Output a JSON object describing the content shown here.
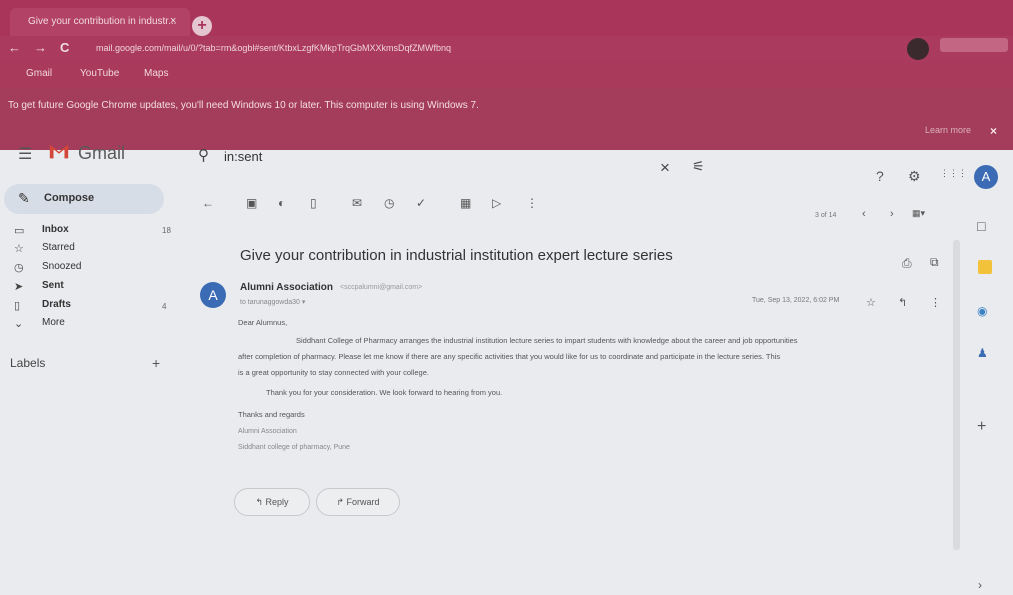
{
  "browser": {
    "tab_title": "Give your contribution in industr...",
    "tab_close": "×",
    "new_tab": "+",
    "back": "←",
    "forward": "→",
    "reload": "C",
    "url": "mail.google.com/mail/u/0/?tab=rm&ogbl#sent/KtbxLzgfKMkpTrqGbMXXkmsDqfZMWfbnq",
    "bookmarks": [
      "Gmail",
      "YouTube",
      "Maps"
    ],
    "infobar_text": "To get future Google Chrome updates, you'll need Windows 10 or later. This computer is using Windows 7.",
    "learn_more": "Learn more",
    "infobar_close": "×"
  },
  "gmail": {
    "logo_text": "Gmail",
    "menu_icon": "☰",
    "search_value": "in:sent",
    "search_clear": "×",
    "search_options": "⚟",
    "help": "?",
    "settings": "⚙",
    "apps": "⋮⋮⋮",
    "user_initial": "A"
  },
  "sidebar": {
    "compose": "Compose",
    "items": [
      {
        "icon": "▭",
        "label": "Inbox",
        "count": "18"
      },
      {
        "icon": "☆",
        "label": "Starred",
        "count": ""
      },
      {
        "icon": "◷",
        "label": "Snoozed",
        "count": ""
      },
      {
        "icon": "➤",
        "label": "Sent",
        "count": ""
      },
      {
        "icon": "▯",
        "label": "Drafts",
        "count": "4"
      },
      {
        "icon": "⌄",
        "label": "More",
        "count": ""
      }
    ],
    "labels_heading": "Labels",
    "labels_add": "+"
  },
  "toolbar": {
    "back": "←",
    "page_info": "3 of 14",
    "prev": "‹",
    "next": "›"
  },
  "message": {
    "subject": "Give your contribution in industrial institution expert lecture series",
    "sender_initial": "A",
    "sender_name": "Alumni Association",
    "sender_email": "<sccpalumni@gmail.com>",
    "to": "to tarunaggowda30 ▾",
    "date": "Tue, Sep 13, 2022, 6:02 PM",
    "greeting": "Dear Alumnus,",
    "body_1": "Siddhant College of Pharmacy arranges the industrial institution lecture series to impart students with knowledge about the career and job opportunities",
    "body_2": "after completion of pharmacy. Please let me know if there are any specific activities that you would like for us to coordinate and participate in the lecture series. This",
    "body_3": "is a great opportunity to stay connected with your college.",
    "body_4": "Thank you for your consideration. We look forward to hearing from you.",
    "thanks": "Thanks and regards",
    "sig_1": "Alumni Association",
    "sig_2": "Siddhant college of pharmacy, Pune",
    "reply": "↰ Reply",
    "forward": "↱ Forward"
  },
  "rail": {
    "add": "+",
    "expand": "›"
  }
}
